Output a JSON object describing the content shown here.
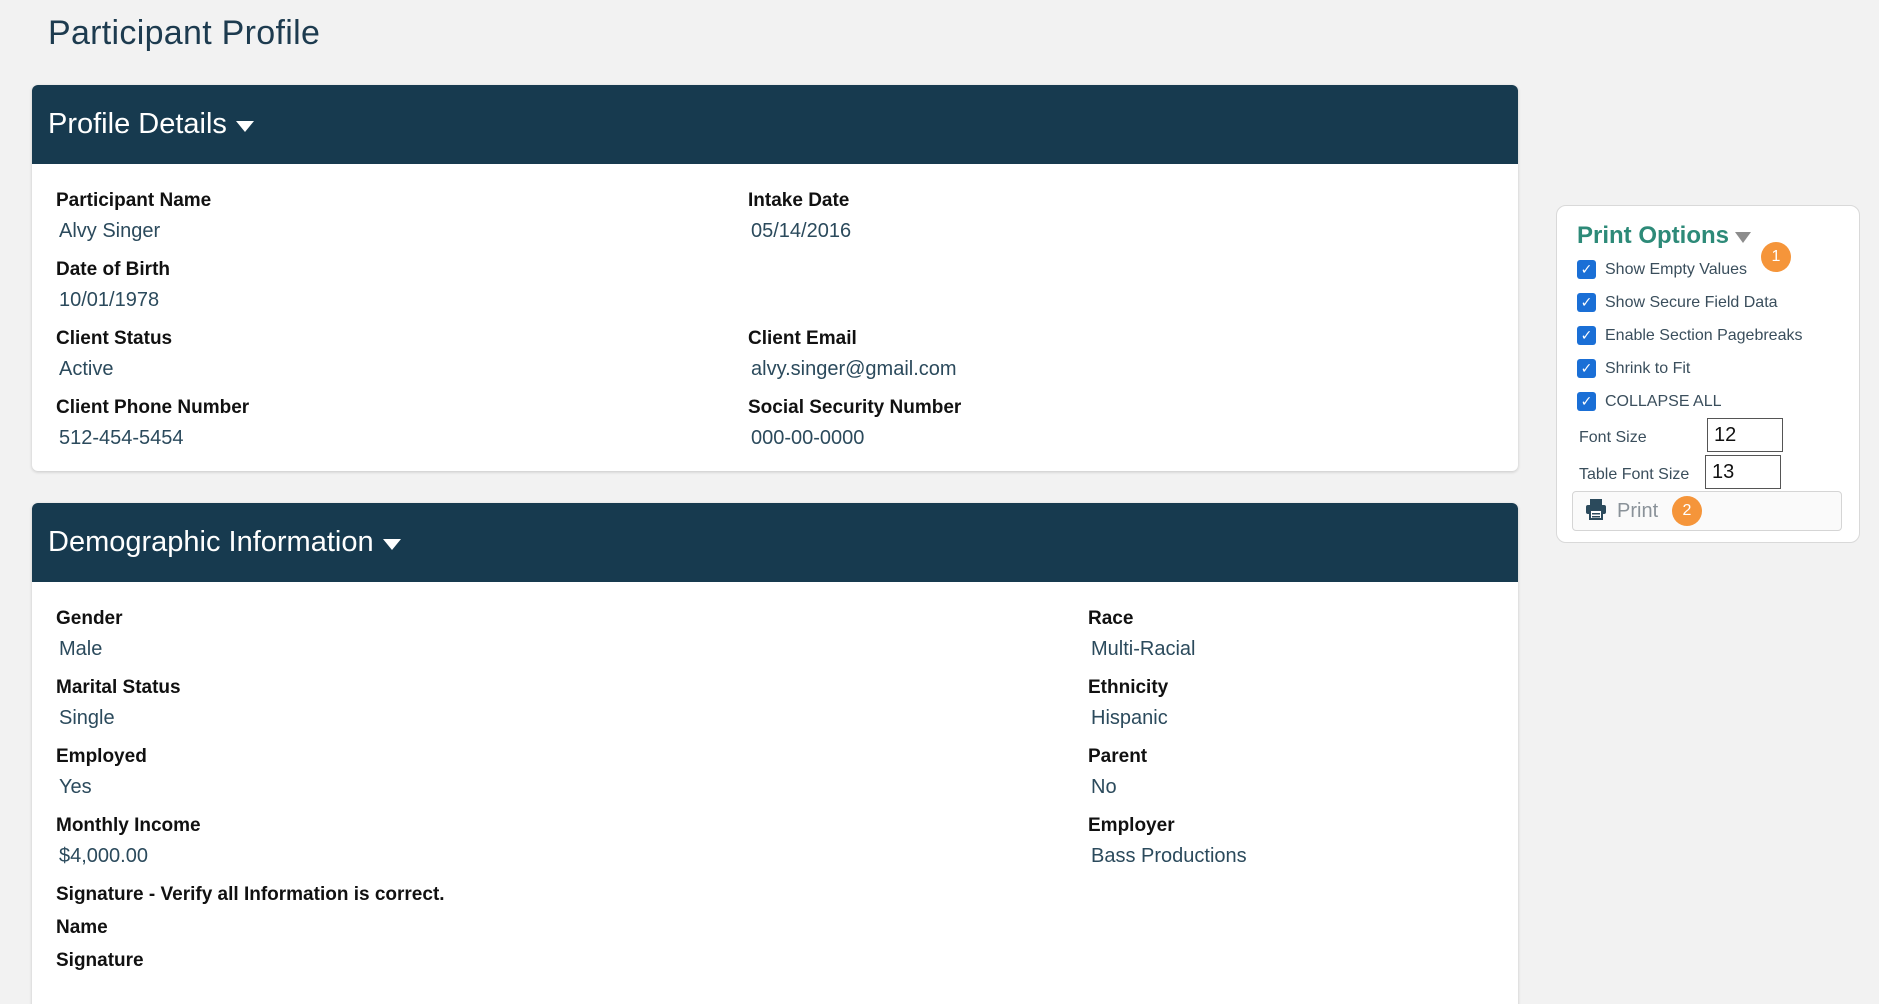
{
  "page_title": "Participant Profile",
  "profile_details": {
    "title": "Profile Details",
    "fields": {
      "participant_name": {
        "label": "Participant Name",
        "value": "Alvy Singer"
      },
      "intake_date": {
        "label": "Intake Date",
        "value": "05/14/2016"
      },
      "date_of_birth": {
        "label": "Date of Birth",
        "value": "10/01/1978"
      },
      "client_status": {
        "label": "Client Status",
        "value": "Active"
      },
      "client_email": {
        "label": "Client Email",
        "value": "alvy.singer@gmail.com"
      },
      "client_phone": {
        "label": "Client Phone Number",
        "value": "512-454-5454"
      },
      "ssn": {
        "label": "Social Security Number",
        "value": "000-00-0000"
      }
    }
  },
  "demographic": {
    "title": "Demographic Information",
    "fields": {
      "gender": {
        "label": "Gender",
        "value": "Male"
      },
      "race": {
        "label": "Race",
        "value": "Multi-Racial"
      },
      "marital_status": {
        "label": "Marital Status",
        "value": "Single"
      },
      "ethnicity": {
        "label": "Ethnicity",
        "value": "Hispanic"
      },
      "employed": {
        "label": "Employed",
        "value": "Yes"
      },
      "parent": {
        "label": "Parent",
        "value": "No"
      },
      "monthly_income": {
        "label": "Monthly Income",
        "value": "$4,000.00"
      },
      "employer": {
        "label": "Employer",
        "value": "Bass Productions"
      }
    },
    "signature_heading": "Signature - Verify all Information is correct.",
    "name_label": "Name",
    "signature_label": "Signature"
  },
  "print_options": {
    "title": "Print Options",
    "badge_1": "1",
    "badge_2": "2",
    "options": [
      {
        "label": "Show Empty Values",
        "checked": true
      },
      {
        "label": "Show Secure Field Data",
        "checked": true
      },
      {
        "label": "Enable Section Pagebreaks",
        "checked": true
      },
      {
        "label": "Shrink to Fit",
        "checked": true
      },
      {
        "label": "COLLAPSE ALL",
        "checked": true
      }
    ],
    "font_size_label": "Font Size",
    "font_size_value": "12",
    "table_font_size_label": "Table Font Size",
    "table_font_size_value": "13",
    "print_label": "Print"
  },
  "colors": {
    "header_bg": "#173a4f",
    "accent_teal": "#2d8a78",
    "badge_orange": "#f5953a",
    "checkbox_blue": "#1a6fd6"
  }
}
